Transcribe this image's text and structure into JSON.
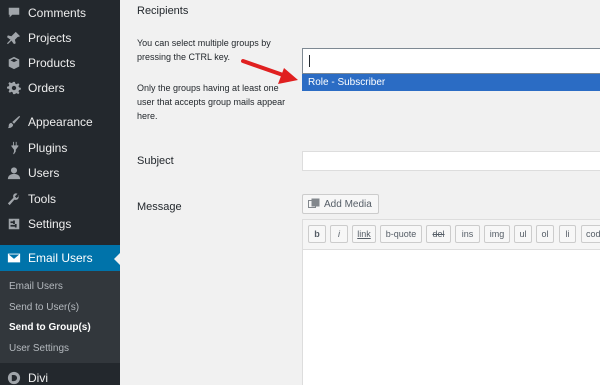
{
  "sidebar": {
    "items": [
      {
        "label": "Comments",
        "icon": "comments-icon"
      },
      {
        "label": "Projects",
        "icon": "pin-icon"
      },
      {
        "label": "Products",
        "icon": "box-icon"
      },
      {
        "label": "Orders",
        "icon": "gear-icon"
      },
      {
        "label": "Appearance",
        "icon": "brush-icon"
      },
      {
        "label": "Plugins",
        "icon": "plug-icon"
      },
      {
        "label": "Users",
        "icon": "user-icon"
      },
      {
        "label": "Tools",
        "icon": "wrench-icon"
      },
      {
        "label": "Settings",
        "icon": "settings-icon"
      },
      {
        "label": "Email Users",
        "icon": "email-icon",
        "active": true
      },
      {
        "label": "Divi",
        "icon": "divi-icon"
      }
    ],
    "submenu": [
      {
        "label": "Email Users"
      },
      {
        "label": "Send to User(s)"
      },
      {
        "label": "Send to Group(s)",
        "current": true
      },
      {
        "label": "User Settings"
      }
    ]
  },
  "form": {
    "section_title": "Recipients",
    "help_1": [
      "You can select multiple groups by",
      "pressing the CTRL key."
    ],
    "help_2": [
      "Only the groups having at least one",
      "user that accepts group mails appear",
      "here."
    ],
    "dropdown_option": "Role - Subscriber",
    "subject_label": "Subject",
    "message_label": "Message",
    "add_media_label": "Add Media"
  },
  "toolbar": {
    "buttons": [
      "b",
      "i",
      "link",
      "b-quote",
      "del",
      "ins",
      "img",
      "ul",
      "ol",
      "li",
      "code"
    ]
  },
  "colors": {
    "sidebar_bg": "#23282d",
    "active_bg": "#0073aa",
    "selected_option_bg": "#2b6cc4",
    "annotation_arrow": "#e02020"
  }
}
